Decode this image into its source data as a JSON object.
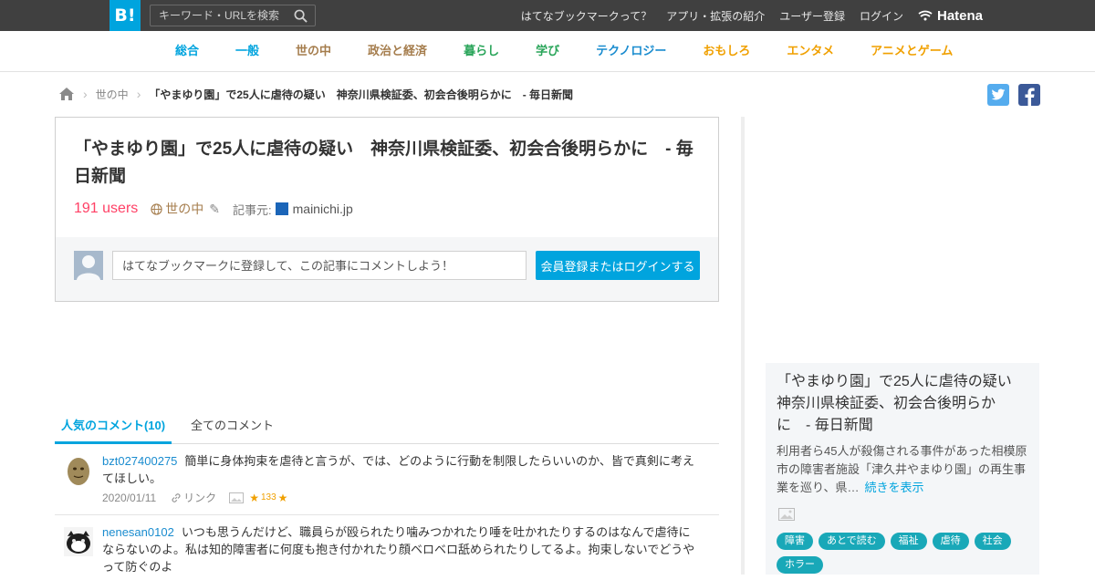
{
  "header": {
    "logo": "B!",
    "search_placeholder": "キーワード・URLを検索",
    "links": [
      "はてなブックマークって？",
      "アプリ・拡張の紹介",
      "ユーザー登録",
      "ログイン"
    ],
    "brand": "Hatena"
  },
  "categories": [
    {
      "label": "総合",
      "color": "#00a4de"
    },
    {
      "label": "一般",
      "color": "#00a4de"
    },
    {
      "label": "世の中",
      "color": "#a57d4d"
    },
    {
      "label": "政治と経済",
      "color": "#a57d4d"
    },
    {
      "label": "暮らし",
      "color": "#2aa55a"
    },
    {
      "label": "学び",
      "color": "#2aa55a"
    },
    {
      "label": "テクノロジー",
      "color": "#1a8ccf"
    },
    {
      "label": "おもしろ",
      "color": "#f0a000"
    },
    {
      "label": "エンタメ",
      "color": "#f0a000"
    },
    {
      "label": "アニメとゲーム",
      "color": "#f0a000"
    }
  ],
  "breadcrumb": {
    "category": "世の中",
    "current": "「やまゆり園」で25人に虐待の疑い　神奈川県検証委、初会合後明らかに　- 毎日新聞"
  },
  "share": {
    "twitter": "t",
    "facebook": "f"
  },
  "entry": {
    "title": "「やまゆり園」で25人に虐待の疑い　神奈川県検証委、初会合後明らかに　- 毎日新聞",
    "users": "191 users",
    "category": "世の中",
    "source_label": "記事元:",
    "source_domain": "mainichi.jp",
    "comment_placeholder": "はてなブックマークに登録して、この記事にコメントしよう！",
    "login_button": "会員登録またはログインする"
  },
  "tabs": {
    "popular": "人気のコメント(10)",
    "all": "全てのコメント"
  },
  "comments": [
    {
      "user": "bzt027400275",
      "text": "簡単に身体拘束を虐待と言うが、では、どのように行動を制限したらいいのか、皆で真剣に考えてほしい。",
      "date": "2020/01/11",
      "link": "リンク",
      "stars": "133"
    },
    {
      "user": "nenesan0102",
      "text": "いつも思うんだけど、職員らが殴られたり噛みつかれたり唾を吐かれたりするのはなんで虐待にならないのよ。私は知的障害者に何度も抱き付かれたり顔ベロベロ舐められたりしてるよ。拘束しないでどうやって防ぐのよ"
    }
  ],
  "sidebar": {
    "title": "「やまゆり園」で25人に虐待の疑い　神奈川県検証委、初会合後明らかに　- 毎日新聞",
    "summary": "利用者ら45人が殺傷される事件があった相模原市の障害者施設「津久井やまゆり園」の再生事業を巡り、県…",
    "more": "続きを表示",
    "tags": [
      "障害",
      "あとで読む",
      "福祉",
      "虐待",
      "社会",
      "ホラー"
    ]
  },
  "colors": {
    "accent": "#00a4de",
    "users": "#ff4166",
    "tag": "#19a8b8",
    "topbar": "#404040"
  }
}
